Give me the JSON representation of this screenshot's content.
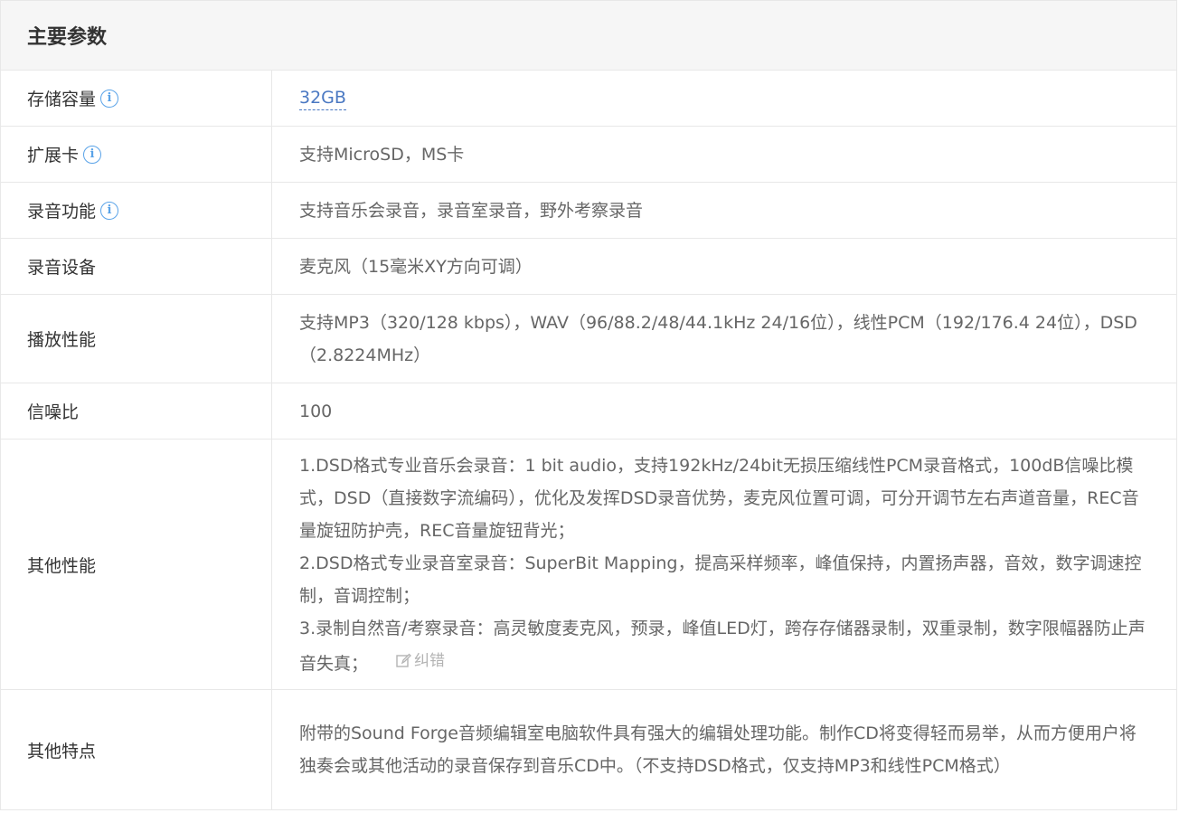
{
  "header": {
    "title": "主要参数"
  },
  "rows": [
    {
      "label": "存储容量",
      "value": "32GB"
    },
    {
      "label": "扩展卡",
      "value": "支持MicroSD，MS卡"
    },
    {
      "label": "录音功能",
      "value": "支持音乐会录音，录音室录音，野外考察录音"
    },
    {
      "label": "录音设备",
      "value": "麦克风（15毫米XY方向可调）"
    },
    {
      "label": "播放性能",
      "value": "支持MP3（320/128 kbps），WAV（96/88.2/48/44.1kHz 24/16位），线性PCM（192/176.4 24位），DSD（2.8224MHz）"
    },
    {
      "label": "信噪比",
      "value": "100"
    },
    {
      "label": "其他性能",
      "lines": [
        "1.DSD格式专业音乐会录音：1 bit audio，支持192kHz/24bit无损压缩线性PCM录音格式，100dB信噪比模式，DSD（直接数字流编码），优化及发挥DSD录音优势，麦克风位置可调，可分开调节左右声道音量，REC音量旋钮防护壳，REC音量旋钮背光；",
        "2.DSD格式专业录音室录音：SuperBit Mapping，提高采样频率，峰值保持，内置扬声器，音效，数字调速控制，音调控制；",
        "3.录制自然音/考察录音：高灵敏度麦克风，预录，峰值LED灯，跨存存储器录制，双重录制，数字限幅器防止声音失真；"
      ],
      "error_label": "纠错"
    },
    {
      "label": "其他特点",
      "value": "附带的Sound Forge音频编辑室电脑软件具有强大的编辑处理功能。制作CD将变得轻而易举，从而方便用户将独奏会或其他活动的录音保存到音乐CD中。（不支持DSD格式，仅支持MP3和线性PCM格式）"
    }
  ],
  "icons": {
    "info": "info-icon",
    "info_glyph": "i",
    "edit": "edit-icon"
  },
  "colors": {
    "header_bg": "#f6f6f6",
    "border": "#e8e8e8",
    "label_text": "#333333",
    "value_text": "#666666",
    "link": "#4a78c2",
    "info_icon": "#5aa3e8",
    "error_link": "#b3b3b3"
  }
}
